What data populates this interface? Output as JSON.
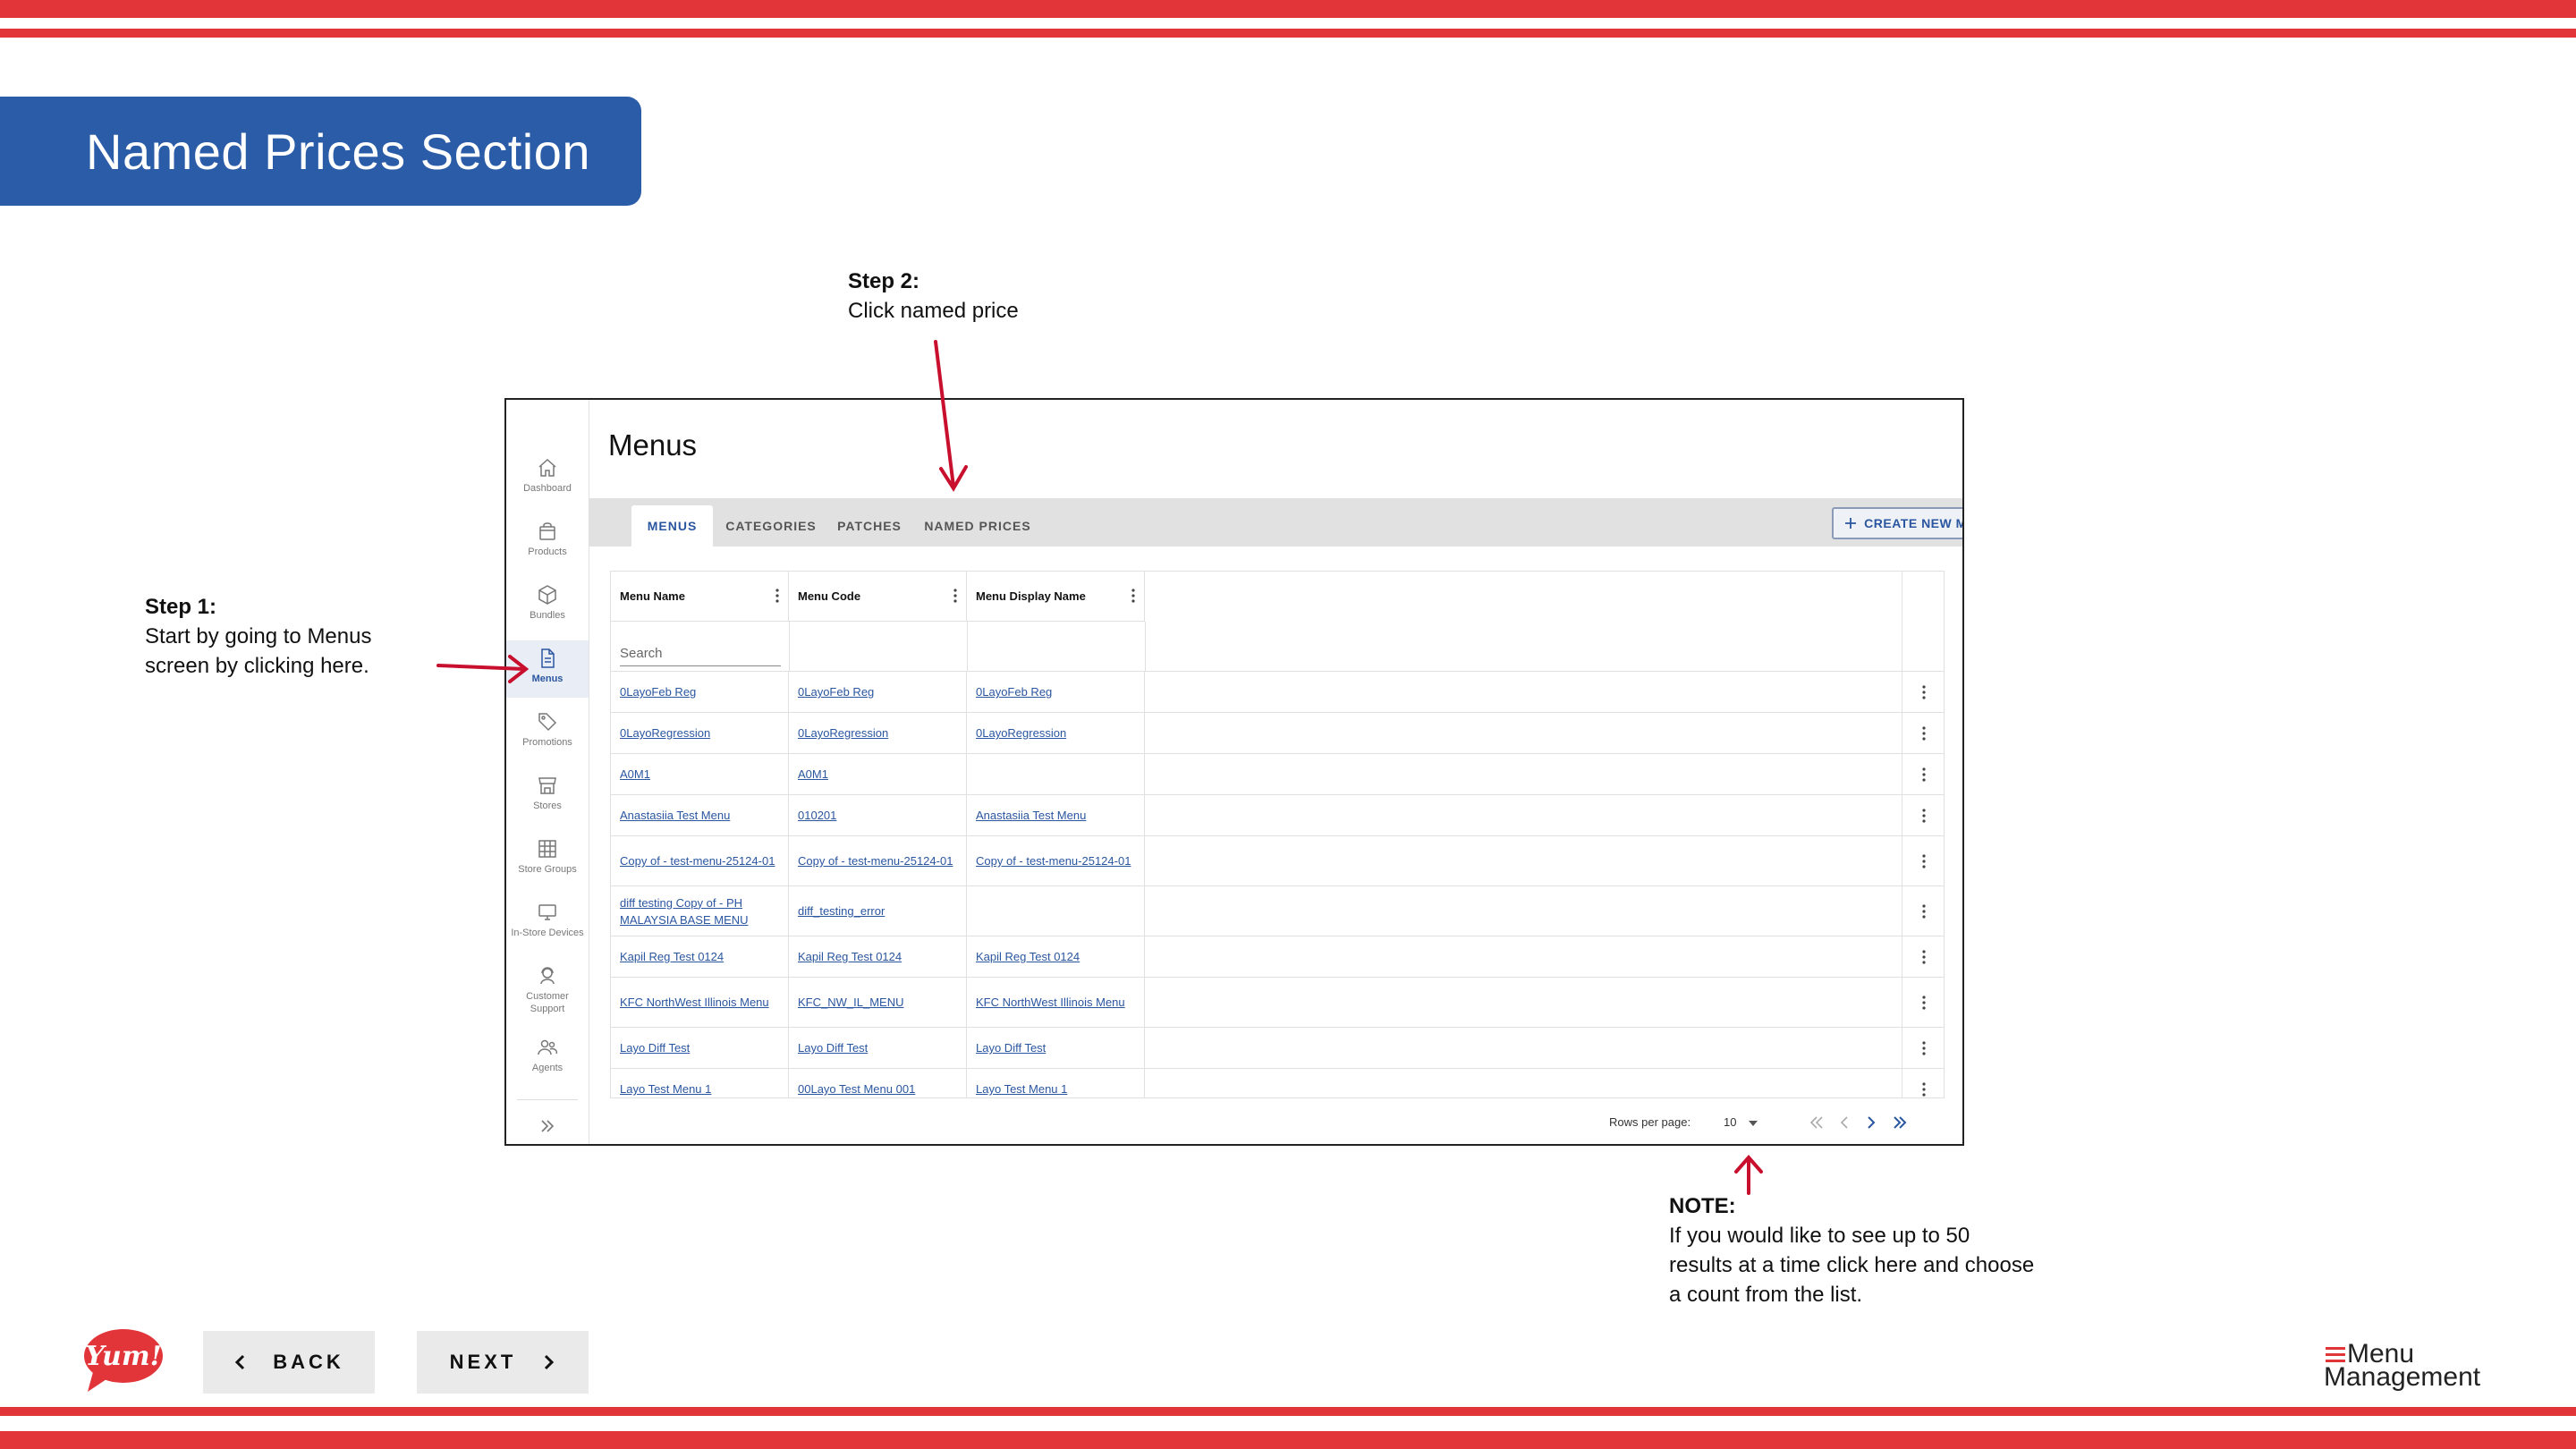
{
  "slide": {
    "title": "Named Prices Section",
    "brand_color": "#e2353a",
    "banner_color": "#2b5ca8"
  },
  "annotations": {
    "step1": {
      "heading": "Step 1:",
      "lines": [
        "Start by going to Menus",
        "screen by clicking here."
      ]
    },
    "step2": {
      "heading": "Step 2:",
      "lines": [
        "Click named price"
      ]
    },
    "note": {
      "heading": "NOTE:",
      "lines": [
        "If you would like to see up to 50",
        "results at a time click here and choose",
        "a count from the list."
      ]
    },
    "arrow_color": "#c8102e"
  },
  "app": {
    "sidebar": {
      "items": [
        {
          "label": "Dashboard",
          "icon": "home-icon"
        },
        {
          "label": "Products",
          "icon": "bag-icon"
        },
        {
          "label": "Bundles",
          "icon": "box-icon"
        },
        {
          "label": "Menus",
          "icon": "document-icon",
          "active": true
        },
        {
          "label": "Promotions",
          "icon": "tag-icon"
        },
        {
          "label": "Stores",
          "icon": "store-icon"
        },
        {
          "label": "Store Groups",
          "icon": "grid-icon"
        },
        {
          "label": "In-Store Devices",
          "icon": "monitor-icon"
        },
        {
          "label": "Customer Support",
          "icon": "headset-icon"
        },
        {
          "label": "Agents",
          "icon": "people-icon"
        }
      ],
      "expand_icon": "double-chevron-right-icon"
    },
    "page_title": "Menus",
    "tabs": [
      {
        "label": "MENUS",
        "active": true
      },
      {
        "label": "CATEGORIES"
      },
      {
        "label": "PATCHES"
      },
      {
        "label": "NAMED PRICES"
      }
    ],
    "create_button": "CREATE NEW MENU",
    "table": {
      "columns": [
        "Menu Name",
        "Menu Code",
        "Menu Display Name"
      ],
      "search_placeholder": "Search",
      "rows": [
        [
          "0LayoFeb Reg",
          "0LayoFeb Reg",
          "0LayoFeb Reg"
        ],
        [
          "0LayoRegression",
          "0LayoRegression",
          "0LayoRegression"
        ],
        [
          "A0M1",
          "A0M1",
          ""
        ],
        [
          "Anastasiia Test Menu",
          "010201",
          "Anastasiia Test Menu"
        ],
        [
          "Copy of - test-menu-25124-01",
          "Copy of - test-menu-25124-01",
          "Copy of - test-menu-25124-01"
        ],
        [
          "diff testing Copy of - PH MALAYSIA BASE MENU",
          "diff_testing_error",
          ""
        ],
        [
          "Kapil Reg Test 0124",
          "Kapil Reg Test 0124",
          "Kapil Reg Test 0124"
        ],
        [
          "KFC NorthWest Illinois Menu",
          "KFC_NW_IL_MENU",
          "KFC NorthWest Illinois Menu"
        ],
        [
          "Layo Diff Test",
          "Layo Diff Test",
          "Layo Diff Test"
        ],
        [
          "Layo Test Menu 1",
          "00Layo Test Menu 001",
          "Layo Test Menu 1"
        ]
      ]
    },
    "pagination": {
      "rows_per_page_label": "Rows per page:",
      "rows_per_page_value": "10"
    }
  },
  "navigation": {
    "back_label": "BACK",
    "next_label": "NEXT"
  },
  "logos": {
    "yum_text": "Yum!",
    "menu_management_line1": "Menu",
    "menu_management_line2": "Management"
  }
}
